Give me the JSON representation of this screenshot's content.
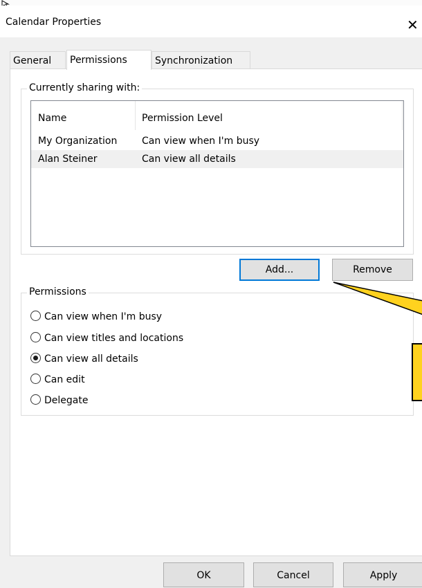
{
  "window": {
    "title": "Calendar Properties",
    "close_glyph": "✕"
  },
  "tabs": [
    {
      "label": "General",
      "active": false
    },
    {
      "label": "Permissions",
      "active": true
    },
    {
      "label": "Synchronization",
      "active": false
    }
  ],
  "sharing": {
    "legend": "Currently sharing with:",
    "columns": [
      "Name",
      "Permission Level"
    ],
    "rows": [
      {
        "name": "My Organization",
        "level": "Can view when I'm busy",
        "selected": false
      },
      {
        "name": "Alan Steiner",
        "level": "Can view all details",
        "selected": true
      }
    ]
  },
  "buttons": {
    "add": "Add...",
    "remove": "Remove"
  },
  "permissions": {
    "legend": "Permissions",
    "options": [
      {
        "label": "Can view when I'm busy",
        "checked": false
      },
      {
        "label": "Can view titles and locations",
        "checked": false
      },
      {
        "label": "Can view all details",
        "checked": true
      },
      {
        "label": "Can edit",
        "checked": false
      },
      {
        "label": "Delegate",
        "checked": false
      }
    ]
  },
  "footer": {
    "ok": "OK",
    "cancel": "Cancel",
    "apply": "Apply"
  },
  "colors": {
    "focus_border": "#0078d7",
    "callout_fill": "#ffd21f",
    "callout_border": "#000000"
  },
  "icons": {
    "cursor": "mouse-cursor-icon",
    "close": "close-icon",
    "radio": "radio-button-icon"
  }
}
